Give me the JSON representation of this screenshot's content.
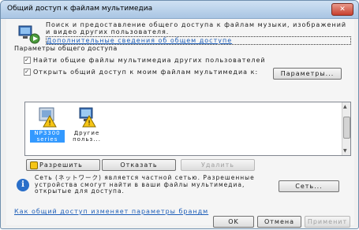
{
  "window": {
    "title": "Общий доступ к файлам мультимедиа",
    "close_glyph": "✕"
  },
  "header": {
    "text": "Поиск и предоставление общего доступа к файлам музыки, изображений и видео других пользователя.",
    "link": "Дополнительные сведения об общем доступе"
  },
  "sharing": {
    "group_label": "Параметры общего доступа",
    "find_label": "Найти общие файлы мультимедиа других пользователей",
    "share_label": "Открыть общий доступ к моим файлам мультимедиа к:",
    "find_checked": true,
    "share_checked": true,
    "check_glyph": "✓",
    "settings_button": "Параметры..."
  },
  "devices": [
    {
      "name": "NP3300 series",
      "selected": true,
      "icon": "network-media-device-icon"
    },
    {
      "name": "Другие польз...",
      "selected": false,
      "icon": "other-users-icon"
    }
  ],
  "actions": {
    "allow": "Разрешить",
    "deny": "Отказать",
    "remove": "Удалить"
  },
  "info": {
    "text": "Сеть (ネットワーク) является частной сетью. Разрешенные устройства смогут найти в ваши файлы мультимедиа, открытые для доступа.",
    "network_button": "Сеть..."
  },
  "bottom_link": "Как общий доступ изменяет параметры брандм",
  "footer": {
    "ok": "OK",
    "cancel": "Отмена",
    "apply": "Применит"
  }
}
